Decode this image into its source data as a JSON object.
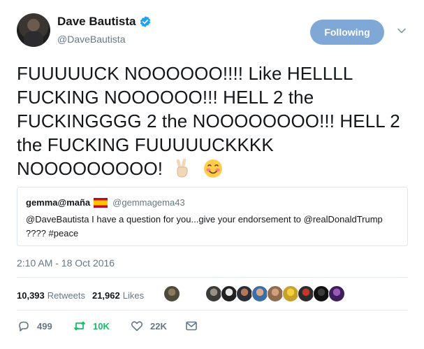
{
  "author": {
    "display_name": "Dave Bautista",
    "handle": "@DaveBautista",
    "verified": true
  },
  "follow_button": {
    "label": "Following"
  },
  "tweet": {
    "text": "FUUUUUCK NOOOOOO!!!! Like HELLLL FUCKING NOOOOOO!!! HELL 2 the FUCKINGGGG 2 the NOOOOOOOO!!! HELL 2 the FUCKING FUUUUUCKKKK NOOOOOOOOO!",
    "emojis": [
      "victory-hand-emoji",
      "smiling-face-blush-emoji"
    ]
  },
  "quoted_tweet": {
    "name": "gemma@maña",
    "flag": "spain-flag-icon",
    "handle": "@gemmagema43",
    "text": "@DaveBautista I have a question for you...give your endorsement to @realDonaldTrump ???? #peace"
  },
  "timestamp": "2:10 AM - 18 Oct 2016",
  "stats": {
    "retweets_count": "10,393",
    "retweets_label": "Retweets",
    "likes_count": "21,962",
    "likes_label": "Likes"
  },
  "likers_avatars": [
    "liker-avatar",
    "liker-avatar",
    "liker-avatar",
    "liker-avatar",
    "liker-avatar",
    "liker-avatar",
    "liker-avatar",
    "liker-avatar",
    "liker-avatar",
    "liker-avatar"
  ],
  "actions": {
    "reply_count": "499",
    "retweet_count": "10K",
    "like_count": "22K"
  },
  "colors": {
    "accent": "#1da1f2",
    "following_button": "#7fa8d6",
    "retweet_active": "#17bf63",
    "muted_text": "#657786"
  }
}
